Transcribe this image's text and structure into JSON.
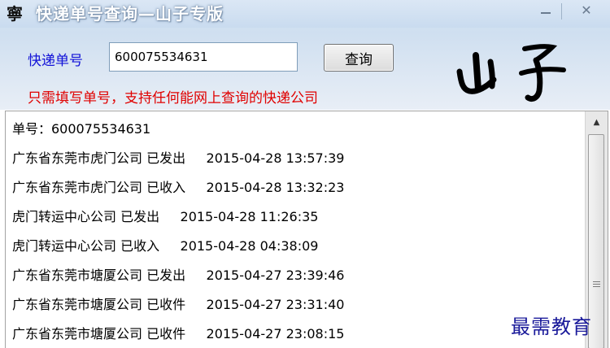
{
  "window": {
    "title": "快递单号查询—山子专版",
    "app_icon_glyph": "寧",
    "minimize_label": "—",
    "close_label": "✕"
  },
  "form": {
    "number_label": "快递单号",
    "number_value": "600075534631",
    "query_button_label": "查询",
    "hint": "只需填写单号，支持任何能网上查询的快递公司"
  },
  "logo": {
    "signature_text": "山子"
  },
  "results": {
    "lines": [
      "单号：600075534631",
      "广东省东莞市虎门公司 已发出     2015-04-28 13:57:39",
      "广东省东莞市虎门公司 已收入     2015-04-28 13:32:23",
      "虎门转运中心公司 已发出     2015-04-28 11:26:35",
      "虎门转运中心公司 已收入     2015-04-28 04:38:09",
      "广东省东莞市塘厦公司 已发出     2015-04-27 23:39:46",
      "广东省东莞市塘厦公司 已收件     2015-04-27 23:31:40",
      "广东省东莞市塘厦公司 已收件     2015-04-27 23:08:15"
    ]
  },
  "watermark": "最需教育",
  "colors": {
    "label_blue": "#1212d8",
    "hint_red": "#e00000",
    "titlebar": "#cfdff0"
  }
}
